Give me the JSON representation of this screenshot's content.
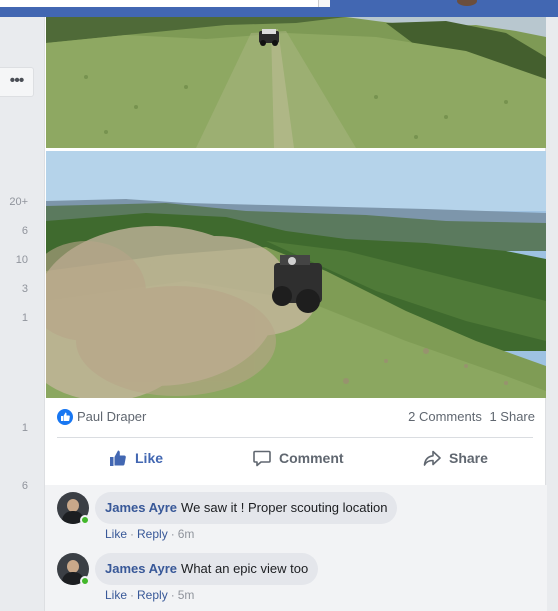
{
  "left_column": {
    "more_label": "•••",
    "counts": [
      "20+",
      "6",
      "10",
      "3",
      "1",
      "1",
      "6"
    ]
  },
  "post": {
    "reactor_name": "Paul Draper",
    "comments_count": "2 Comments",
    "shares_count": "1 Share"
  },
  "actions": {
    "like_label": "Like",
    "comment_label": "Comment",
    "share_label": "Share"
  },
  "comments": [
    {
      "author": "James Ayre",
      "text": "We saw it ! Proper scouting location",
      "like_label": "Like",
      "reply_label": "Reply",
      "time": "6m"
    },
    {
      "author": "James Ayre",
      "text": "What an epic view too",
      "like_label": "Like",
      "reply_label": "Reply",
      "time": "5m"
    }
  ],
  "colors": {
    "facebook_blue": "#4267b2",
    "link_blue": "#385898",
    "online_green": "#42b72a"
  }
}
